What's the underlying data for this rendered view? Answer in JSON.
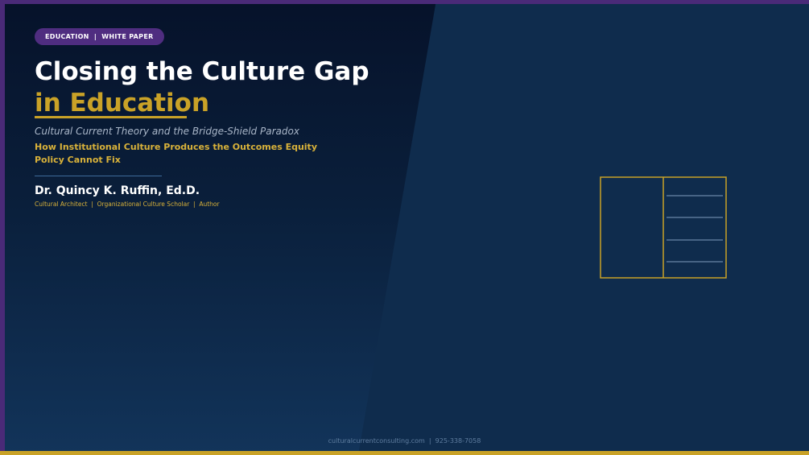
{
  "badge": {
    "label": "EDUCATION  |  WHITE PAPER"
  },
  "title": {
    "line1": "Closing the Culture Gap",
    "line2": "in Education"
  },
  "subtitle": "Cultural Current Theory and the Bridge-Shield Paradox",
  "tagline": "How Institutional Culture Produces the Outcomes Equity Policy Cannot Fix",
  "author": {
    "name": "Dr. Quincy K. Ruffin, Ed.D.",
    "roles": "Cultural Architect  |  Organizational Culture Scholar  |  Author"
  },
  "footer": {
    "contact": "culturalcurrentconsulting.com  |  925-338-7058"
  },
  "colors": {
    "background": "#0f2c4d",
    "accent_gold": "#c9a227",
    "accent_purple": "#4a2a78",
    "text_white": "#ffffff"
  },
  "icons": {
    "document": "document-outline-icon"
  }
}
